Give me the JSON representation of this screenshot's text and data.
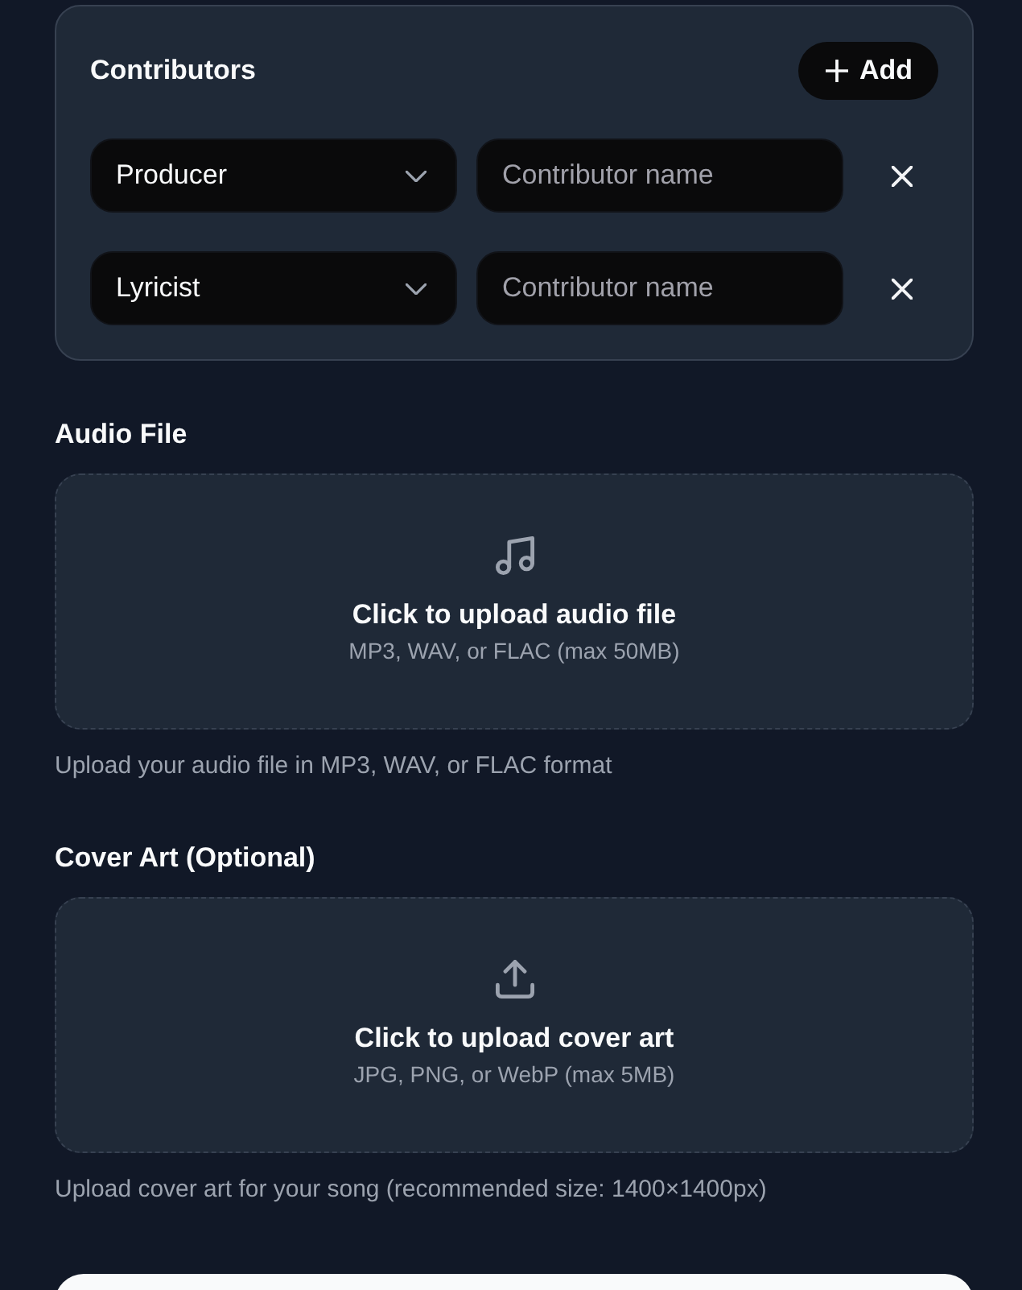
{
  "contributors": {
    "title": "Contributors",
    "add_button": "Add",
    "rows": [
      {
        "role": "Producer",
        "placeholder": "Contributor name"
      },
      {
        "role": "Lyricist",
        "placeholder": "Contributor name"
      }
    ]
  },
  "uploads": [
    {
      "kind": "audio",
      "label": "Audio File",
      "title": "Click to upload audio file",
      "subtitle": "MP3, WAV, or FLAC (max 50MB)",
      "help": "Upload your audio file in MP3, WAV, or FLAC format"
    },
    {
      "kind": "image",
      "label": "Cover Art (Optional)",
      "title": "Click to upload cover art",
      "subtitle": "JPG, PNG, or WebP (max 5MB)",
      "help": "Upload cover art for your song (recommended size: 1400×1400px)"
    }
  ],
  "bottom_button": {
    "kind": "primary"
  }
}
